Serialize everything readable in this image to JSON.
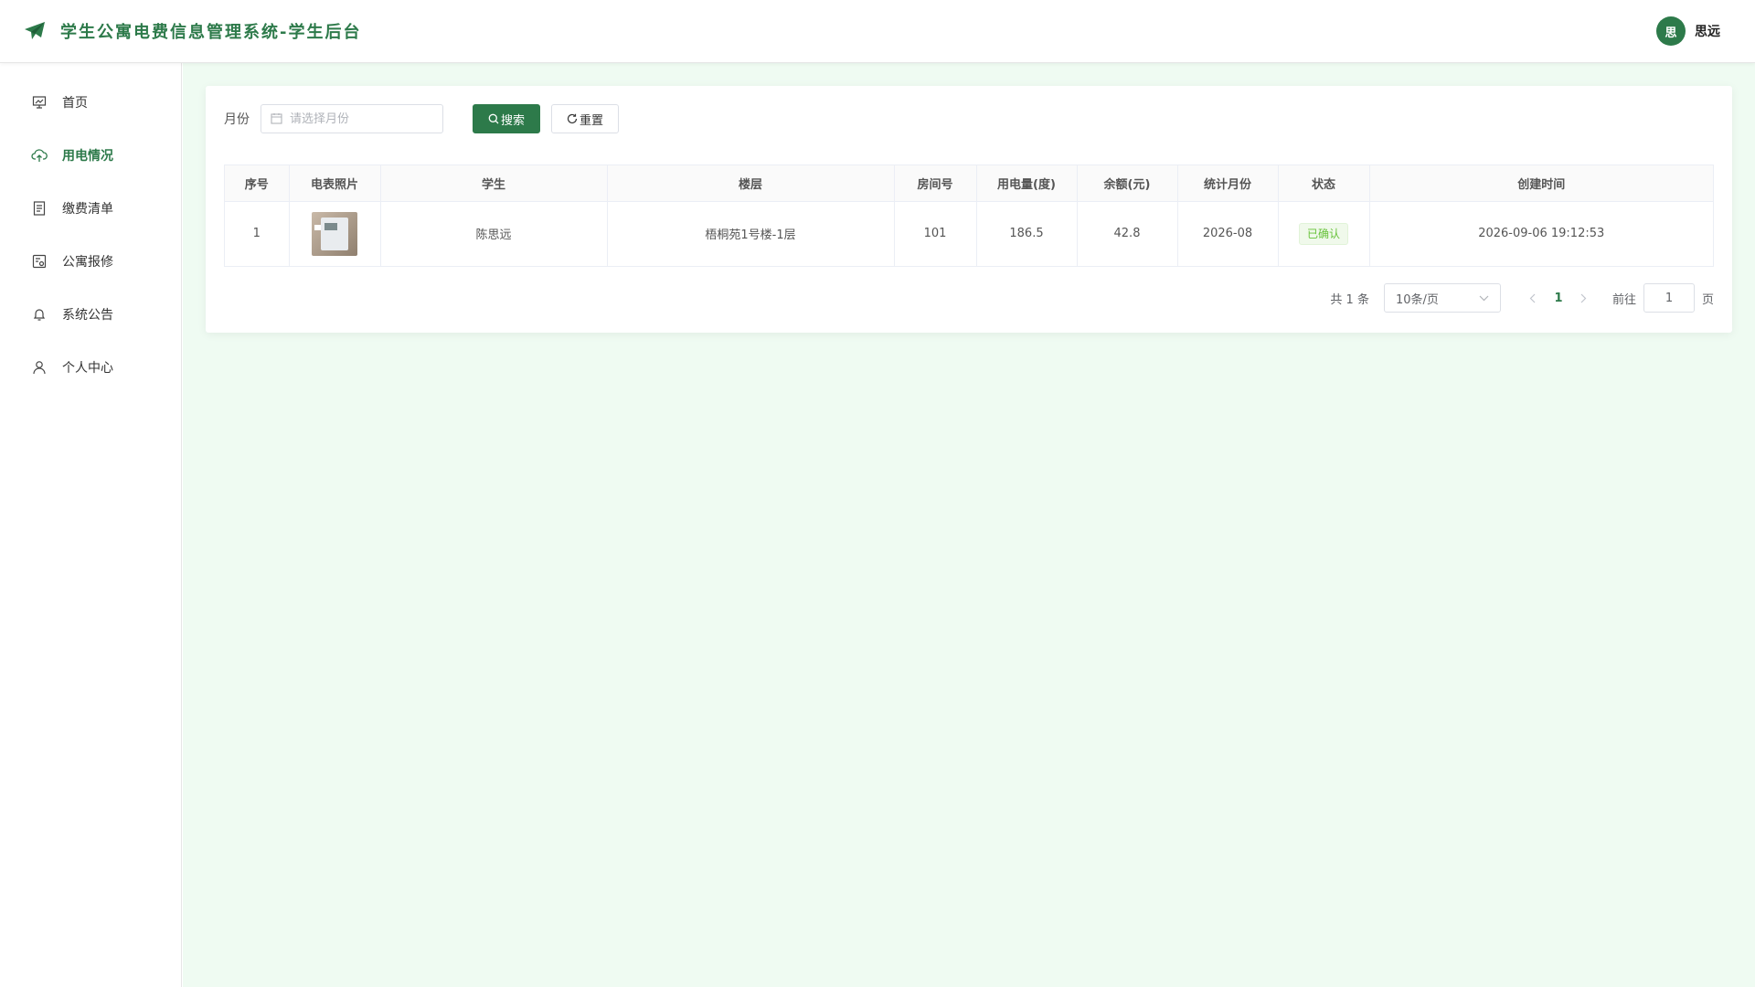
{
  "header": {
    "title": "学生公寓电费信息管理系统-学生后台",
    "user_avatar_text": "思",
    "user_name": "思远"
  },
  "sidebar": {
    "items": [
      {
        "label": "首页",
        "icon": "presentation-icon",
        "active": false
      },
      {
        "label": "用电情况",
        "icon": "cloud-icon",
        "active": true
      },
      {
        "label": "缴费清单",
        "icon": "document-icon",
        "active": false
      },
      {
        "label": "公寓报修",
        "icon": "repair-icon",
        "active": false
      },
      {
        "label": "系统公告",
        "icon": "bell-icon",
        "active": false
      },
      {
        "label": "个人中心",
        "icon": "user-icon",
        "active": false
      }
    ]
  },
  "search": {
    "label": "月份",
    "placeholder": "请选择月份",
    "search_label": "搜索",
    "reset_label": "重置"
  },
  "table": {
    "columns": [
      "序号",
      "电表照片",
      "学生",
      "楼层",
      "房间号",
      "用电量(度)",
      "余额(元)",
      "统计月份",
      "状态",
      "创建时间"
    ],
    "rows": [
      {
        "index": "1",
        "photo": "meter-photo",
        "student": "陈思远",
        "floor": "梧桐苑1号楼-1层",
        "room": "101",
        "usage": "186.5",
        "balance": "42.8",
        "month": "2026-08",
        "status": "已确认",
        "created": "2026-09-06 19:12:53"
      }
    ]
  },
  "pagination": {
    "total": "共 1 条",
    "page_size": "10条/页",
    "current": "1",
    "goto_label": "前往",
    "goto_value": "1",
    "page_unit": "页"
  },
  "colors": {
    "primary": "#2d7a4a",
    "main_bg": "#effbf2",
    "tag_success": "#67c23a"
  }
}
